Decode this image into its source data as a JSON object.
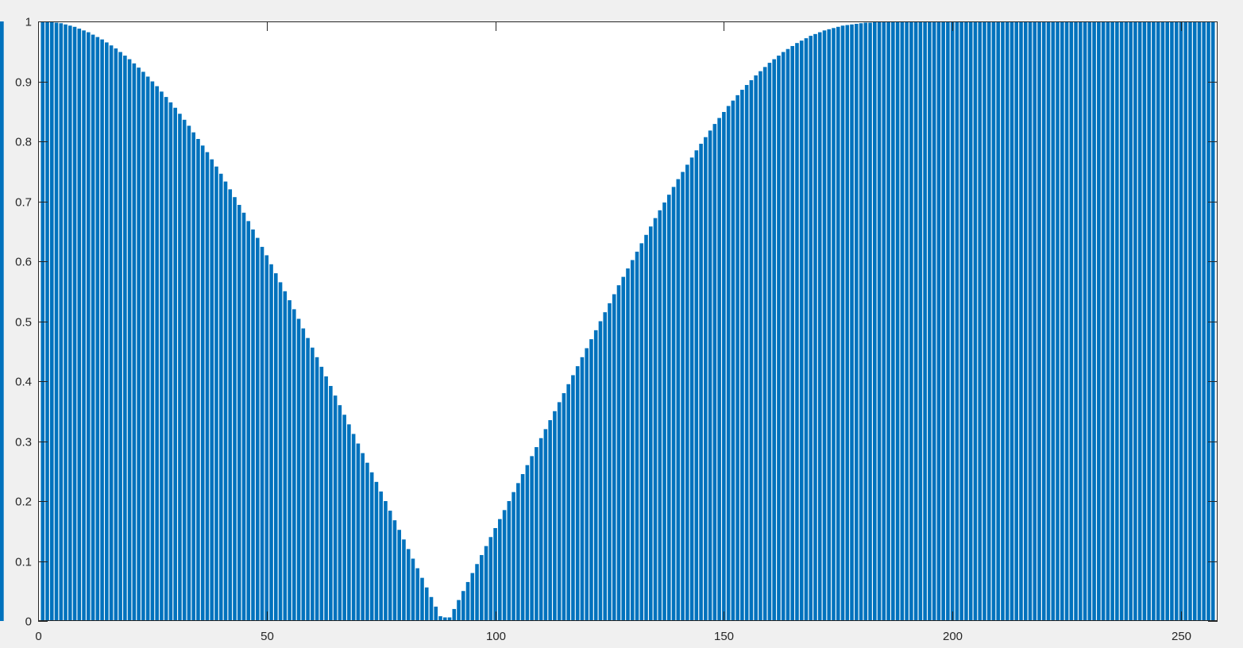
{
  "figure": {
    "background": "#f0f0f0"
  },
  "chart_data": {
    "type": "bar",
    "title": "",
    "xlabel": "",
    "ylabel": "",
    "xlim": [
      0,
      258
    ],
    "ylim": [
      0,
      1
    ],
    "grid": false,
    "bar_color": "#0072bd",
    "axes_color": "#262626",
    "x_ticks": [
      "0",
      "50",
      "100",
      "150",
      "200",
      "250"
    ],
    "y_ticks": [
      "0",
      "0.1",
      "0.2",
      "0.3",
      "0.4",
      "0.5",
      "0.6",
      "0.7",
      "0.8",
      "0.9",
      "1"
    ],
    "x": [
      1,
      2,
      3,
      4,
      5,
      6,
      7,
      8,
      9,
      10,
      11,
      12,
      13,
      14,
      15,
      16,
      17,
      18,
      19,
      20,
      21,
      22,
      23,
      24,
      25,
      26,
      27,
      28,
      29,
      30,
      31,
      32,
      33,
      34,
      35,
      36,
      37,
      38,
      39,
      40,
      41,
      42,
      43,
      44,
      45,
      46,
      47,
      48,
      49,
      50,
      51,
      52,
      53,
      54,
      55,
      56,
      57,
      58,
      59,
      60,
      61,
      62,
      63,
      64,
      65,
      66,
      67,
      68,
      69,
      70,
      71,
      72,
      73,
      74,
      75,
      76,
      77,
      78,
      79,
      80,
      81,
      82,
      83,
      84,
      85,
      86,
      87,
      88,
      89,
      90,
      91,
      92,
      93,
      94,
      95,
      96,
      97,
      98,
      99,
      100,
      101,
      102,
      103,
      104,
      105,
      106,
      107,
      108,
      109,
      110,
      111,
      112,
      113,
      114,
      115,
      116,
      117,
      118,
      119,
      120,
      121,
      122,
      123,
      124,
      125,
      126,
      127,
      128,
      129,
      130,
      131,
      132,
      133,
      134,
      135,
      136,
      137,
      138,
      139,
      140,
      141,
      142,
      143,
      144,
      145,
      146,
      147,
      148,
      149,
      150,
      151,
      152,
      153,
      154,
      155,
      156,
      157,
      158,
      159,
      160,
      161,
      162,
      163,
      164,
      165,
      166,
      167,
      168,
      169,
      170,
      171,
      172,
      173,
      174,
      175,
      176,
      177,
      178,
      179,
      180,
      181,
      182,
      183,
      184,
      185,
      186,
      187,
      188,
      189,
      190,
      191,
      192,
      193,
      194,
      195,
      196,
      197,
      198,
      199,
      200,
      201,
      202,
      203,
      204,
      205,
      206,
      207,
      208,
      209,
      210,
      211,
      212,
      213,
      214,
      215,
      216,
      217,
      218,
      219,
      220,
      221,
      222,
      223,
      224,
      225,
      226,
      227,
      228,
      229,
      230,
      231,
      232,
      233,
      234,
      235,
      236,
      237,
      238,
      239,
      240,
      241,
      242,
      243,
      244,
      245,
      246,
      247,
      248,
      249,
      250,
      251,
      252,
      253,
      254,
      255,
      256,
      257
    ],
    "values": [
      1,
      1,
      0.999,
      0.998,
      0.997,
      0.995,
      0.993,
      0.991,
      0.988,
      0.985,
      0.982,
      0.978,
      0.974,
      0.97,
      0.965,
      0.96,
      0.955,
      0.949,
      0.943,
      0.937,
      0.93,
      0.923,
      0.916,
      0.908,
      0.9,
      0.892,
      0.883,
      0.874,
      0.865,
      0.856,
      0.846,
      0.836,
      0.826,
      0.815,
      0.804,
      0.793,
      0.782,
      0.77,
      0.758,
      0.746,
      0.733,
      0.72,
      0.707,
      0.694,
      0.681,
      0.667,
      0.653,
      0.639,
      0.624,
      0.61,
      0.595,
      0.58,
      0.565,
      0.55,
      0.535,
      0.52,
      0.504,
      0.488,
      0.472,
      0.456,
      0.44,
      0.424,
      0.408,
      0.392,
      0.376,
      0.36,
      0.344,
      0.328,
      0.312,
      0.296,
      0.28,
      0.264,
      0.248,
      0.232,
      0.216,
      0.2,
      0.184,
      0.168,
      0.152,
      0.136,
      0.12,
      0.104,
      0.088,
      0.072,
      0.056,
      0.04,
      0.024,
      0.008,
      0.006,
      0.006,
      0.02,
      0.035,
      0.05,
      0.065,
      0.08,
      0.095,
      0.11,
      0.125,
      0.14,
      0.155,
      0.17,
      0.185,
      0.2,
      0.215,
      0.23,
      0.245,
      0.26,
      0.275,
      0.29,
      0.305,
      0.32,
      0.335,
      0.35,
      0.365,
      0.38,
      0.395,
      0.41,
      0.425,
      0.44,
      0.455,
      0.47,
      0.485,
      0.5,
      0.515,
      0.53,
      0.545,
      0.56,
      0.574,
      0.588,
      0.602,
      0.616,
      0.63,
      0.644,
      0.658,
      0.672,
      0.685,
      0.698,
      0.711,
      0.724,
      0.737,
      0.749,
      0.761,
      0.773,
      0.785,
      0.796,
      0.807,
      0.818,
      0.829,
      0.839,
      0.849,
      0.859,
      0.868,
      0.877,
      0.886,
      0.894,
      0.902,
      0.91,
      0.917,
      0.924,
      0.931,
      0.937,
      0.943,
      0.949,
      0.954,
      0.959,
      0.964,
      0.968,
      0.972,
      0.976,
      0.979,
      0.982,
      0.985,
      0.987,
      0.989,
      0.991,
      0.993,
      0.994,
      0.995,
      0.996,
      0.997,
      0.998,
      0.998,
      0.999,
      0.999,
      0.999,
      1,
      1,
      1,
      1,
      1,
      1,
      1,
      1,
      1,
      1,
      1,
      1,
      1,
      1,
      1,
      1,
      1,
      1,
      1,
      1,
      1,
      1,
      1,
      1,
      1,
      1,
      1,
      1,
      1,
      1,
      1,
      1,
      1,
      1,
      1,
      1,
      1,
      1,
      1,
      1,
      1,
      1,
      1,
      1,
      1,
      1,
      1,
      1,
      1,
      1,
      1,
      1,
      1,
      1,
      1,
      1,
      1,
      1,
      1,
      1,
      1,
      1,
      1,
      1,
      1,
      1,
      1,
      1,
      1,
      1,
      1,
      1,
      1,
      1
    ]
  }
}
